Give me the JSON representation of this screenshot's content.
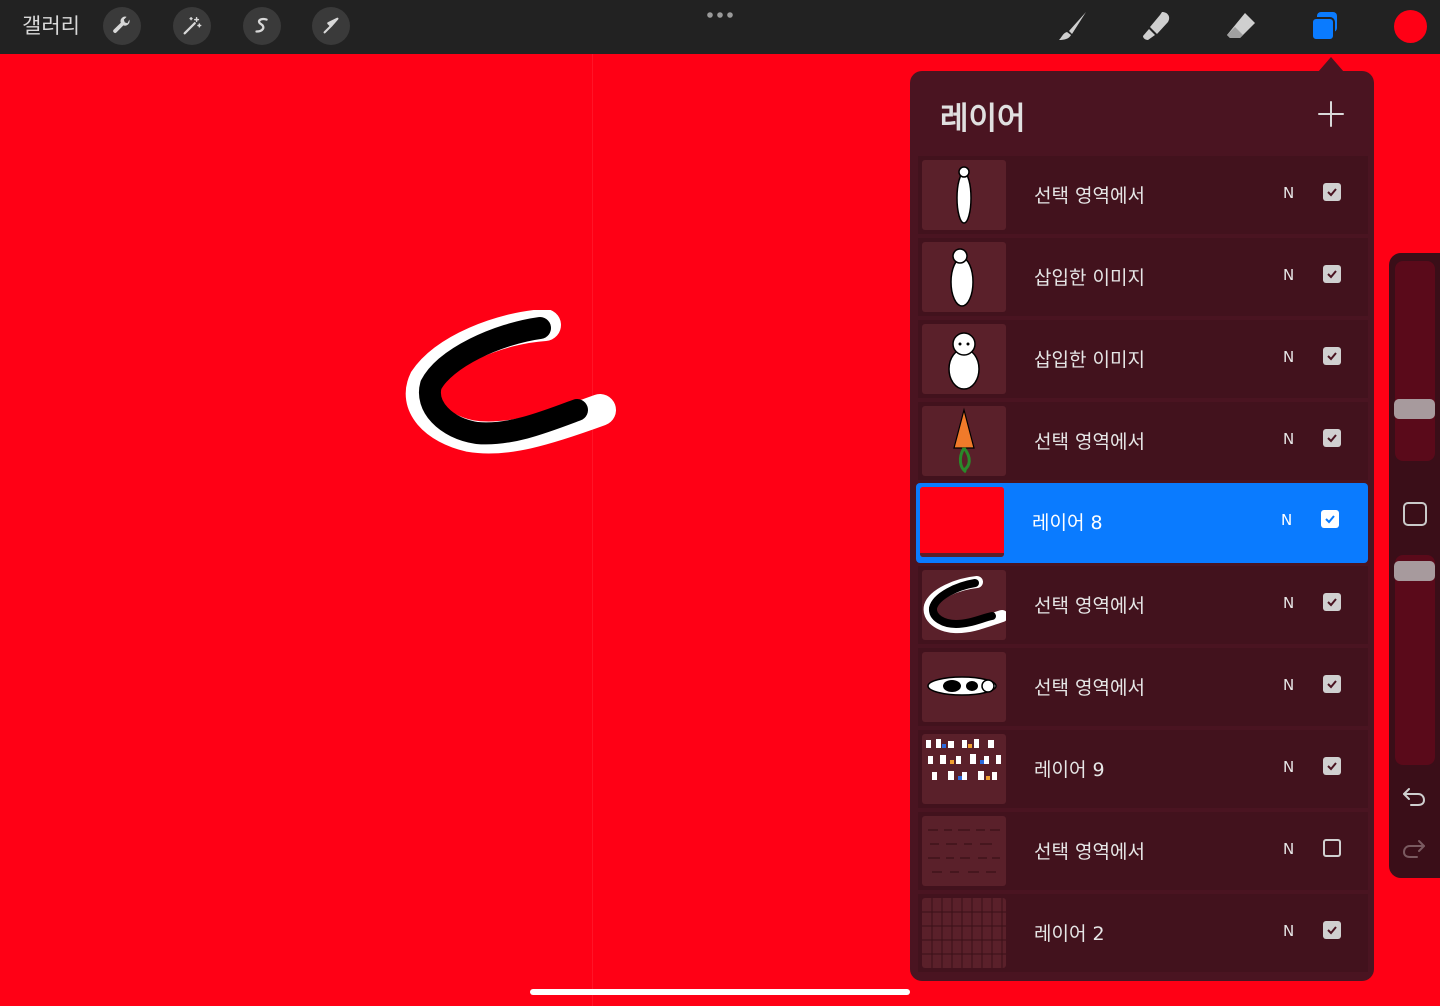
{
  "toolbar": {
    "gallery_label": "갤러리",
    "left_tools": [
      "wrench-icon",
      "magic-wand-icon",
      "selection-s-icon",
      "transform-arrow-icon"
    ],
    "right_tools": [
      "brush-icon",
      "smudge-icon",
      "eraser-icon",
      "layers-icon"
    ],
    "active_tool": "layers-icon",
    "current_color": "#ff0015"
  },
  "canvas": {
    "background_color": "#ff0015"
  },
  "layers_panel": {
    "title": "레이어",
    "layers": [
      {
        "name": "선택 영역에서",
        "blend": "N",
        "visible": true,
        "selected": false,
        "thumb": "alpaca-tall"
      },
      {
        "name": "삽입한 이미지",
        "blend": "N",
        "visible": true,
        "selected": false,
        "thumb": "alpaca-standing"
      },
      {
        "name": "삽입한 이미지",
        "blend": "N",
        "visible": true,
        "selected": false,
        "thumb": "alpaca-front"
      },
      {
        "name": "선택 영역에서",
        "blend": "N",
        "visible": true,
        "selected": false,
        "thumb": "carrot"
      },
      {
        "name": "레이어 8",
        "blend": "N",
        "visible": true,
        "selected": true,
        "thumb": "red-fill"
      },
      {
        "name": "선택 영역에서",
        "blend": "N",
        "visible": true,
        "selected": false,
        "thumb": "black-stroke"
      },
      {
        "name": "선택 영역에서",
        "blend": "N",
        "visible": true,
        "selected": false,
        "thumb": "lying-animal"
      },
      {
        "name": "레이어 9",
        "blend": "N",
        "visible": true,
        "selected": false,
        "thumb": "sticker-sheet"
      },
      {
        "name": "선택 영역에서",
        "blend": "N",
        "visible": false,
        "selected": false,
        "thumb": "faint-sketch"
      },
      {
        "name": "레이어 2",
        "blend": "N",
        "visible": true,
        "selected": false,
        "thumb": "grid"
      }
    ]
  },
  "sidebar": {
    "brush_size_level": 0.19,
    "opacity_level": 0.1,
    "icons": [
      "modifier-square-icon",
      "undo-icon",
      "redo-icon"
    ]
  },
  "colors": {
    "panel_bg": "#4a1421",
    "row_bg": "#42121d",
    "selected_row": "#0a7bff",
    "topbar": "#222222"
  }
}
